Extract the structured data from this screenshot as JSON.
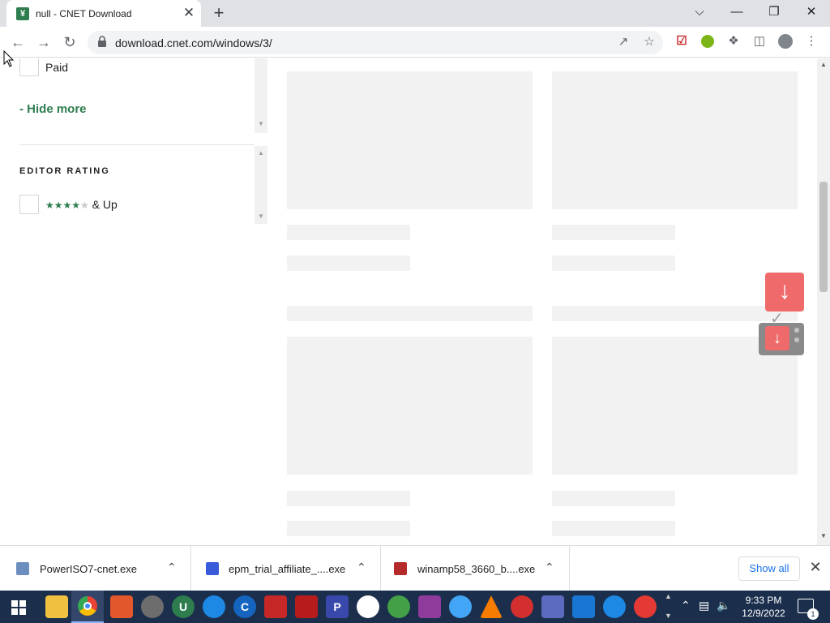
{
  "browser": {
    "tab_title": "null - CNET Download",
    "url": "download.cnet.com/windows/3/",
    "favicon_letter": "¥",
    "close_glyph": "✕",
    "newtab_glyph": "+",
    "window_controls": [
      "⌵",
      "—",
      "❐",
      "✕"
    ]
  },
  "filters": {
    "paid_label": "Paid",
    "hide_more": "-  Hide more",
    "editor_rating_heading": "EDITOR RATING",
    "rating_stars_filled": "★★★★",
    "rating_stars_empty": "★",
    "rating_suffix": " & Up"
  },
  "downloads": {
    "items": [
      {
        "name": "PowerISO7-cnet.exe",
        "icon_color": "#6c8ebf"
      },
      {
        "name": "epm_trial_affiliate_....exe",
        "icon_color": "#3a5bd9"
      },
      {
        "name": "winamp58_3660_b....exe",
        "icon_color": "#b52a2a"
      }
    ],
    "show_all": "Show all",
    "close_glyph": "✕",
    "chevron_glyph": "⌃"
  },
  "taskbar": {
    "time": "9:33 PM",
    "date": "12/9/2022",
    "notification_count": "1"
  },
  "colors": {
    "brand_green": "#2e7d4f",
    "download_red": "#ef6b6b",
    "taskbar": "#1b2f4c"
  }
}
